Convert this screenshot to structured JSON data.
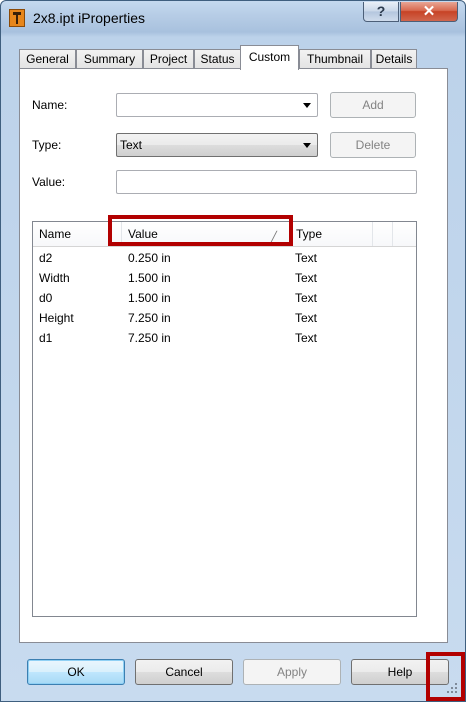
{
  "window": {
    "title": "2x8.ipt iProperties",
    "help_button": "?",
    "close_button": "✕"
  },
  "tabs": [
    {
      "label": "General"
    },
    {
      "label": "Summary"
    },
    {
      "label": "Project"
    },
    {
      "label": "Status"
    },
    {
      "label": "Custom"
    },
    {
      "label": "Thumbnail"
    },
    {
      "label": "Details"
    }
  ],
  "active_tab": "Custom",
  "custom": {
    "name_label": "Name:",
    "name_value": "",
    "type_label": "Type:",
    "type_value": "Text",
    "value_label": "Value:",
    "value_value": "",
    "add_button": "Add",
    "delete_button": "Delete"
  },
  "table": {
    "columns": [
      "Name",
      "Value",
      "Type"
    ],
    "rows": [
      {
        "name": "d2",
        "value": "0.250 in",
        "type": "Text"
      },
      {
        "name": "Width",
        "value": "1.500 in",
        "type": "Text"
      },
      {
        "name": "d0",
        "value": "1.500 in",
        "type": "Text"
      },
      {
        "name": "Height",
        "value": "7.250 in",
        "type": "Text"
      },
      {
        "name": "d1",
        "value": "7.250 in",
        "type": "Text"
      }
    ]
  },
  "buttons": {
    "ok": "OK",
    "cancel": "Cancel",
    "apply": "Apply",
    "help": "Help"
  },
  "colors": {
    "highlight": "#b20000",
    "title_bar": "#b7cde6"
  },
  "icons": {
    "app": "inventor-app-icon",
    "sort": "sort-indicator-icon",
    "dropdown": "chevron-down-icon",
    "resize": "resize-grip-icon"
  }
}
